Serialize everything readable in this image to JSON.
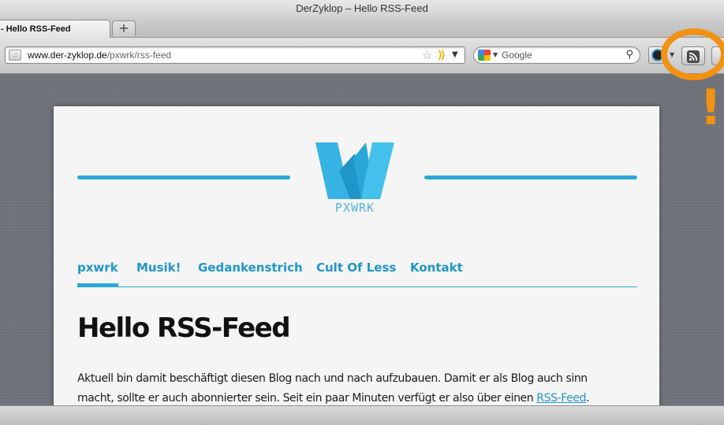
{
  "window": {
    "title": "DerZyklop – Hello RSS-Feed"
  },
  "tabs": [
    {
      "label": "- Hello RSS-Feed"
    }
  ],
  "toolbar": {
    "url_domain": "www.der-zyklop.de",
    "url_path": "/pxwrk/rss-feed",
    "search_placeholder": "Google",
    "rss_icon": "rss-feed-icon",
    "highlight_color": "#f29212",
    "highlight_mark": "!"
  },
  "site": {
    "logo_text": "PXWRK",
    "accent_color": "#2aa7d8",
    "nav": [
      {
        "label": "pxwrk"
      },
      {
        "label": "Musik!"
      },
      {
        "label": "Gedankenstrich"
      },
      {
        "label": "Cult Of Less"
      },
      {
        "label": "Kontakt"
      }
    ]
  },
  "post": {
    "title": "Hello RSS-Feed",
    "line1": "Aktuell bin damit beschäftigt diesen Blog nach und nach aufzubauen. Damit er als Blog auch sinn",
    "line2_before": "macht, sollte er auch abonnierter sein. Seit ein paar Minuten verfügt er also über einen ",
    "line2_link": "RSS-Feed",
    "line2_after": "."
  }
}
